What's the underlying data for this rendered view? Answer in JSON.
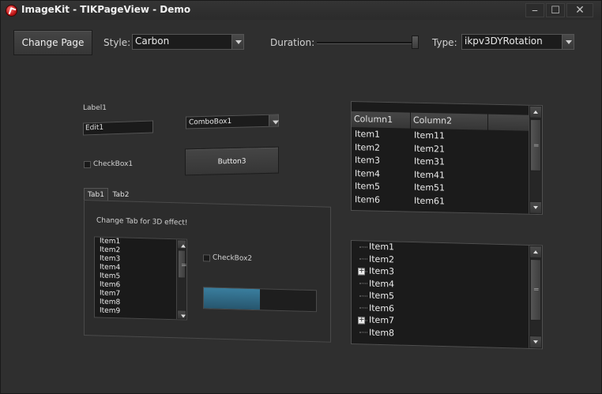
{
  "window": {
    "title": "ImageKit - TIKPageView - Demo",
    "minimize_glyph": "⎯",
    "maximize_glyph": "☐",
    "close_glyph": "✕"
  },
  "toolbar": {
    "change_page_label": "Change Page",
    "style_label": "Style:",
    "style_value": "Carbon",
    "duration_label": "Duration:",
    "duration_level": 0.95,
    "type_label": "Type:",
    "type_value": "ikpv3DYRotation"
  },
  "page": {
    "label1": "Label1",
    "edit1": "Edit1",
    "combobox1": "ComboBox1",
    "checkbox1": "CheckBox1",
    "button3": "Button3",
    "tabs": [
      "Tab1",
      "Tab2"
    ],
    "tab_caption": "Change Tab for 3D effect!",
    "checkbox2": "CheckBox2",
    "progress_value": 0.5,
    "inner_list": [
      "Item1",
      "Item2",
      "Item3",
      "Item4",
      "Item5",
      "Item6",
      "Item7",
      "Item8",
      "Item9"
    ]
  },
  "listview": {
    "columns": [
      "Column1",
      "Column2"
    ],
    "rows": [
      [
        "Item1",
        "Item11"
      ],
      [
        "Item2",
        "Item21"
      ],
      [
        "Item3",
        "Item31"
      ],
      [
        "Item4",
        "Item41"
      ],
      [
        "Item5",
        "Item51"
      ],
      [
        "Item6",
        "Item61"
      ]
    ]
  },
  "tree": {
    "items": [
      {
        "label": "Item1",
        "expandable": false
      },
      {
        "label": "Item2",
        "expandable": false
      },
      {
        "label": "Item3",
        "expandable": true
      },
      {
        "label": "Item4",
        "expandable": false
      },
      {
        "label": "Item5",
        "expandable": false
      },
      {
        "label": "Item6",
        "expandable": false
      },
      {
        "label": "Item7",
        "expandable": true
      },
      {
        "label": "Item8",
        "expandable": false
      }
    ],
    "expander_glyph": "+"
  }
}
